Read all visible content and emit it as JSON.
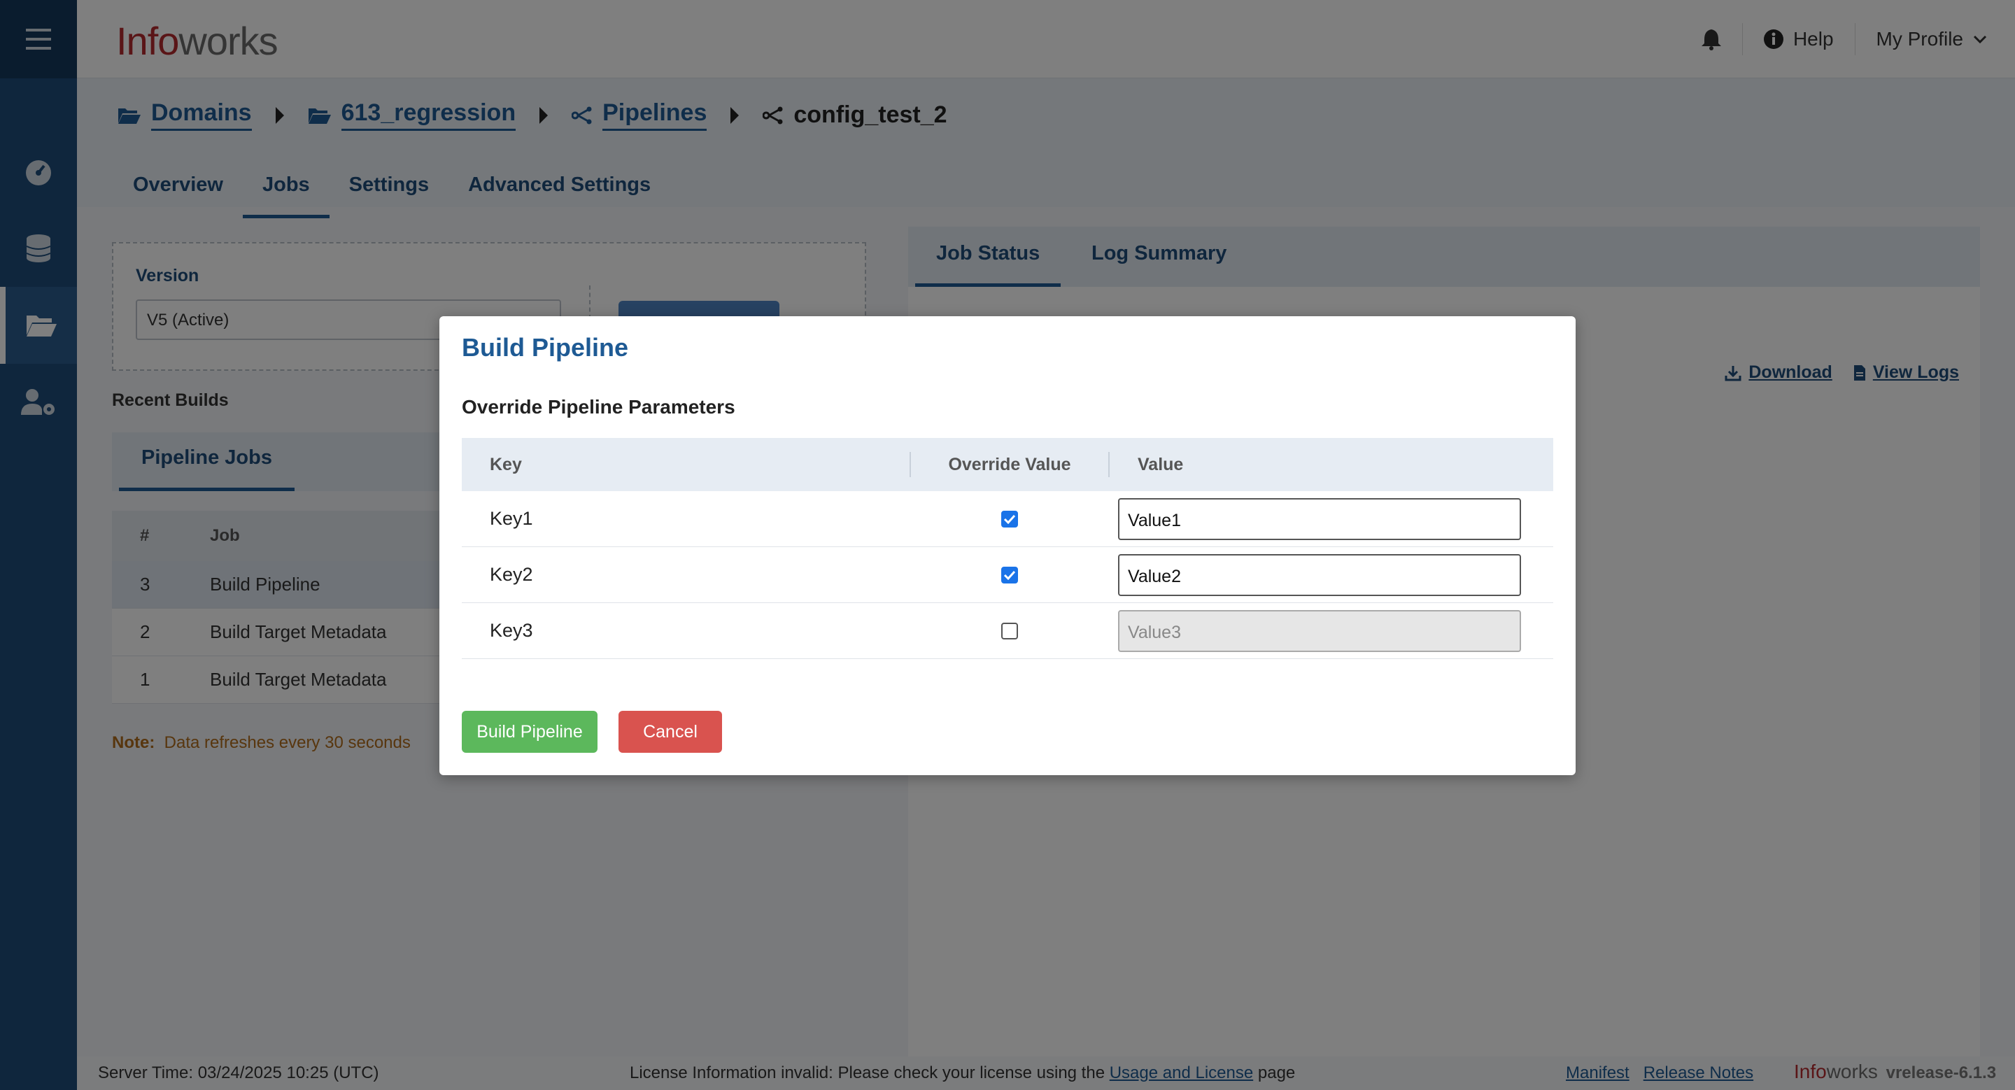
{
  "app": {
    "brand_info": "Info",
    "brand_works": "works",
    "help_label": "Help",
    "profile_label": "My Profile"
  },
  "breadcrumb": {
    "domains": "Domains",
    "domain": "613_regression",
    "pipelines": "Pipelines",
    "pipeline": "config_test_2"
  },
  "tabs": [
    "Overview",
    "Jobs",
    "Settings",
    "Advanced Settings"
  ],
  "left_panel": {
    "version_label": "Version",
    "version_value": "V5 (Active)",
    "recent_builds": "Recent Builds",
    "pipeline_jobs_tab": "Pipeline Jobs",
    "table_headers": [
      "#",
      "Job"
    ],
    "rows": [
      {
        "num": "3",
        "job": "Build Pipeline"
      },
      {
        "num": "2",
        "job": "Build Target Metadata"
      },
      {
        "num": "1",
        "job": "Build Target Metadata"
      }
    ],
    "note_label": "Note:",
    "note_text": "Data refreshes every 30 seconds"
  },
  "right_panel": {
    "tab_job_status": "Job Status",
    "tab_log_summary": "Log Summary",
    "download": "Download",
    "view_logs": "View Logs"
  },
  "modal": {
    "title": "Build Pipeline",
    "subtitle": "Override Pipeline Parameters",
    "headers": {
      "key": "Key",
      "override": "Override Value",
      "value": "Value"
    },
    "params": [
      {
        "key": "Key1",
        "override": true,
        "value": "Value1"
      },
      {
        "key": "Key2",
        "override": true,
        "value": "Value2"
      },
      {
        "key": "Key3",
        "override": false,
        "value": "Value3"
      }
    ],
    "build_button": "Build Pipeline",
    "cancel_button": "Cancel"
  },
  "footer": {
    "server_time": "Server Time: 03/24/2025 10:25 (UTC)",
    "license_prefix": "License Information invalid: Please check your license using the",
    "license_link": "Usage and License",
    "license_suffix": "page",
    "manifest": "Manifest",
    "release_notes": "Release Notes",
    "version": "vrelease-6.1.3"
  },
  "colors": {
    "sidebar": "#1e4d7b",
    "accent": "#1e5a94",
    "brand_red": "#b52a2e",
    "build_green": "#5cb85c",
    "cancel_red": "#d9534f"
  }
}
